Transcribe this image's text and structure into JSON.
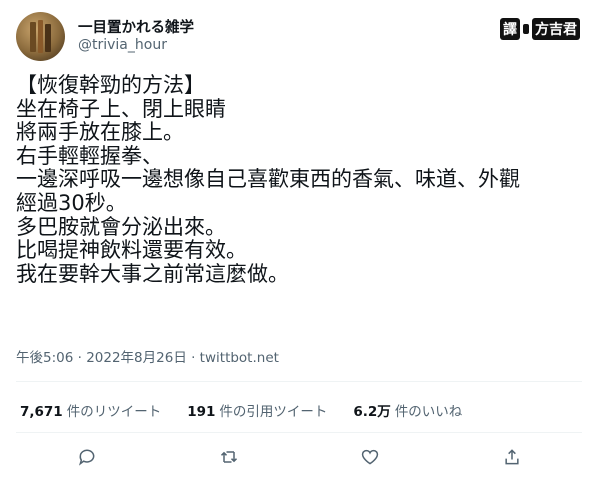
{
  "author": {
    "name": "一目置かれる雑学",
    "handle": "@trivia_hour"
  },
  "translator": {
    "label": "譯",
    "name": "方吉君"
  },
  "tweet": {
    "lines": [
      "【恢復幹勁的方法】",
      "坐在椅子上、閉上眼睛",
      "將兩手放在膝上。",
      "右手輕輕握拳、",
      "一邊深呼吸一邊想像自己喜歡東西的香氣、味道、外觀",
      "經過30秒。",
      "多巴胺就會分泌出來。",
      "比喝提神飲料還要有效。",
      "我在要幹大事之前常這麼做。"
    ],
    "meta": "午後5:06 · 2022年8月26日 · twittbot.net"
  },
  "stats": {
    "retweets_count": "7,671",
    "retweets_label": "件のリツイート",
    "quotes_count": "191",
    "quotes_label": "件の引用ツイート",
    "likes_count": "6.2万",
    "likes_label": "件のいいね"
  },
  "actions": {
    "reply_icon": "reply-icon",
    "retweet_icon": "retweet-icon",
    "like_icon": "heart-icon",
    "share_icon": "share-icon"
  }
}
